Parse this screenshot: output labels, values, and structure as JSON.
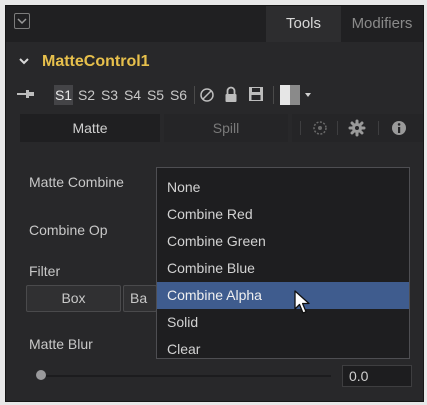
{
  "tabs": {
    "tools": "Tools",
    "modifiers": "Modifiers"
  },
  "node": {
    "name": "MatteControl1"
  },
  "toolbar": {
    "slots": [
      "S1",
      "S2",
      "S3",
      "S4",
      "S5",
      "S6"
    ],
    "active_slot": "S1"
  },
  "section_tabs": {
    "matte": "Matte",
    "spill": "Spill"
  },
  "controls": {
    "matte_combine_label": "Matte Combine",
    "combine_op_label": "Combine Op",
    "filter_label": "Filter",
    "filter_options": [
      "Box",
      "Ba"
    ],
    "matte_blur_label": "Matte Blur",
    "matte_blur_value": "0.0"
  },
  "dropdown": {
    "options": [
      "None",
      "Combine Red",
      "Combine Green",
      "Combine Blue",
      "Combine Alpha",
      "Solid",
      "Clear"
    ],
    "highlighted": "Combine Alpha"
  },
  "colors": {
    "accent": "#e7c04c",
    "highlight": "#3f5c8e",
    "panel": "#28282a"
  }
}
